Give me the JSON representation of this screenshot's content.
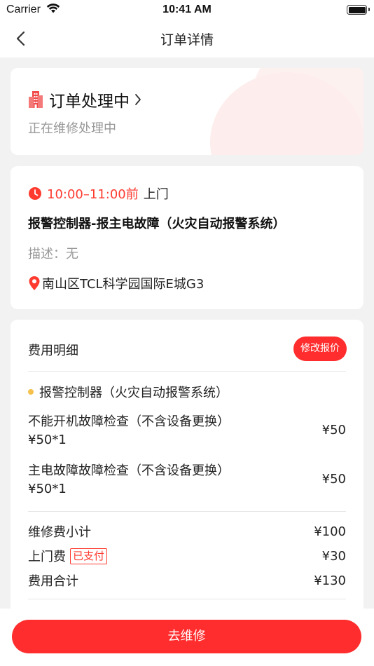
{
  "status_bar": {
    "carrier": "Carrier",
    "time": "10:41 AM"
  },
  "nav": {
    "title": "订单详情"
  },
  "status_card": {
    "status": "订单处理中",
    "sub_status": "正在维修处理中"
  },
  "info_card": {
    "time": "10:00–11:00前",
    "door": "上门",
    "product": "报警控制器-报主电故障（火灾自动报警系统）",
    "description": "描述：无",
    "address": "南山区TCL科学园国际E城G3"
  },
  "fee_card": {
    "title": "费用明细",
    "modify_label": "修改报价",
    "category": "报警控制器（火灾自动报警系统）",
    "items": [
      {
        "name": "不能开机故障检查（不含设备更换）",
        "qty": "¥50*1",
        "price": "¥50"
      },
      {
        "name": "主电故障故障检查（不含设备更换）",
        "qty": "¥50*1",
        "price": "¥50"
      }
    ],
    "subtotal_label": "维修费小计",
    "subtotal_value": "¥100",
    "visit_fee_label": "上门费",
    "visit_fee_badge": "已支付",
    "visit_fee_value": "¥30",
    "total_label": "费用合计",
    "total_value": "¥130"
  },
  "action": {
    "go_repair_label": "去维修"
  },
  "colors": {
    "accent": "#ff2d2d",
    "dot": "#f5c04b",
    "muted": "#999999"
  },
  "icons": {
    "back": "chevron-left-icon",
    "building": "building-icon",
    "clock": "clock-icon",
    "pin": "location-pin-icon"
  }
}
